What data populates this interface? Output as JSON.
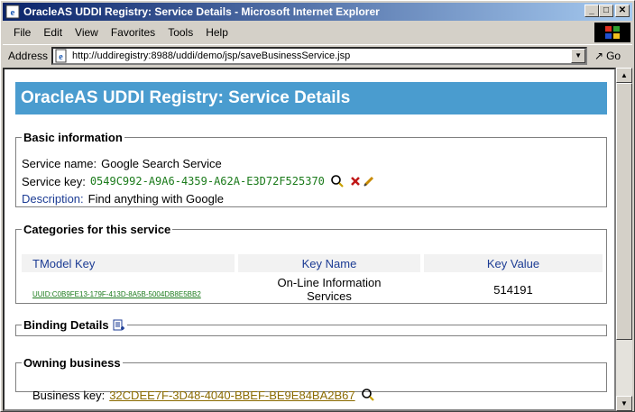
{
  "window": {
    "title": "OracleAS UDDI Registry: Service Details - Microsoft Internet Explorer",
    "minimize": "_",
    "maximize": "□",
    "close": "✕"
  },
  "menu": [
    "File",
    "Edit",
    "View",
    "Favorites",
    "Tools",
    "Help"
  ],
  "address": {
    "label": "Address",
    "url": "http://uddiregistry:8988/uddi/demo/jsp/saveBusinessService.jsp",
    "go_label": "Go"
  },
  "page": {
    "header": "OracleAS UDDI Registry: Service Details",
    "basic": {
      "legend": "Basic information",
      "name_label": "Service name:",
      "name_value": "Google Search Service",
      "key_label": "Service key:",
      "key_value": "0549C992-A9A6-4359-A62A-E3D72F525370",
      "desc_label": "Description:",
      "desc_value": "Find anything with Google"
    },
    "categories": {
      "legend": "Categories for this service",
      "headers": [
        "TModel Key",
        "Key Name",
        "Key Value"
      ],
      "rows": [
        {
          "tmodel_key": "UUID:C0B9FE13-179F-413D-8A5B-5004DB8E5BB2",
          "key_name_line1": "On-Line Information",
          "key_name_line2": "Services",
          "key_value": "514191"
        }
      ]
    },
    "binding": {
      "legend": "Binding Details"
    },
    "owning": {
      "legend": "Owning business",
      "key_label": "Business key:",
      "key_value": "32CDEE7F-3D48-4040-BBEF-BE9E84BA2B67"
    }
  },
  "colors": {
    "header_bg": "#4a9ccf",
    "key_green": "#1a7a1a",
    "label_blue": "#1c3c94",
    "business_link": "#8a6a00",
    "titlebar": "#0a246a"
  }
}
